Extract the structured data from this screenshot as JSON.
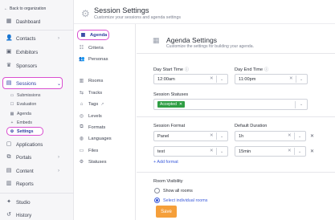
{
  "sidebar": {
    "back_label": "Back to organization",
    "dashboard": "Dashboard",
    "contacts": "Contacts",
    "exhibitors": "Exhibitors",
    "sponsors": "Sponsors",
    "sessions": "Sessions",
    "session_sub": [
      "Submissions",
      "Evaluation",
      "Agenda",
      "Embeds",
      "Settings"
    ],
    "applications": "Applications",
    "portals": "Portals",
    "content": "Content",
    "reports": "Reports",
    "studio": "Studio",
    "history": "History"
  },
  "header": {
    "title": "Session Settings",
    "subtitle": "Customize your sessions and agenda settings"
  },
  "subnav": {
    "items": [
      "Agenda",
      "Criteria",
      "Personas",
      "Rooms",
      "Tracks",
      "Tags",
      "Levels",
      "Formats",
      "Languages",
      "Files",
      "Statuses"
    ]
  },
  "agenda": {
    "title": "Agenda Settings",
    "subtitle": "Customize the settings for building your agenda.",
    "day_start_label": "Day Start Time",
    "day_start_value": "12:00am",
    "day_end_label": "Day End Time",
    "day_end_value": "11:00pm",
    "statuses_label": "Session Statuses",
    "status_tag": "Accepted",
    "format_label": "Session Format",
    "duration_label": "Default Duration",
    "formats": [
      {
        "format": "Panel",
        "duration": "1h"
      },
      {
        "format": "test",
        "duration": "15min"
      }
    ],
    "add_format": "+ Add format",
    "room_visibility_label": "Room Visibility",
    "room_options": [
      "Show all rooms",
      "Select individual rooms"
    ],
    "save_label": "Save"
  },
  "colors": {
    "accent": "#3b5bdb",
    "save": "#f59f3a",
    "tag_green": "#2f9e44",
    "highlight": "#d94fd0"
  }
}
